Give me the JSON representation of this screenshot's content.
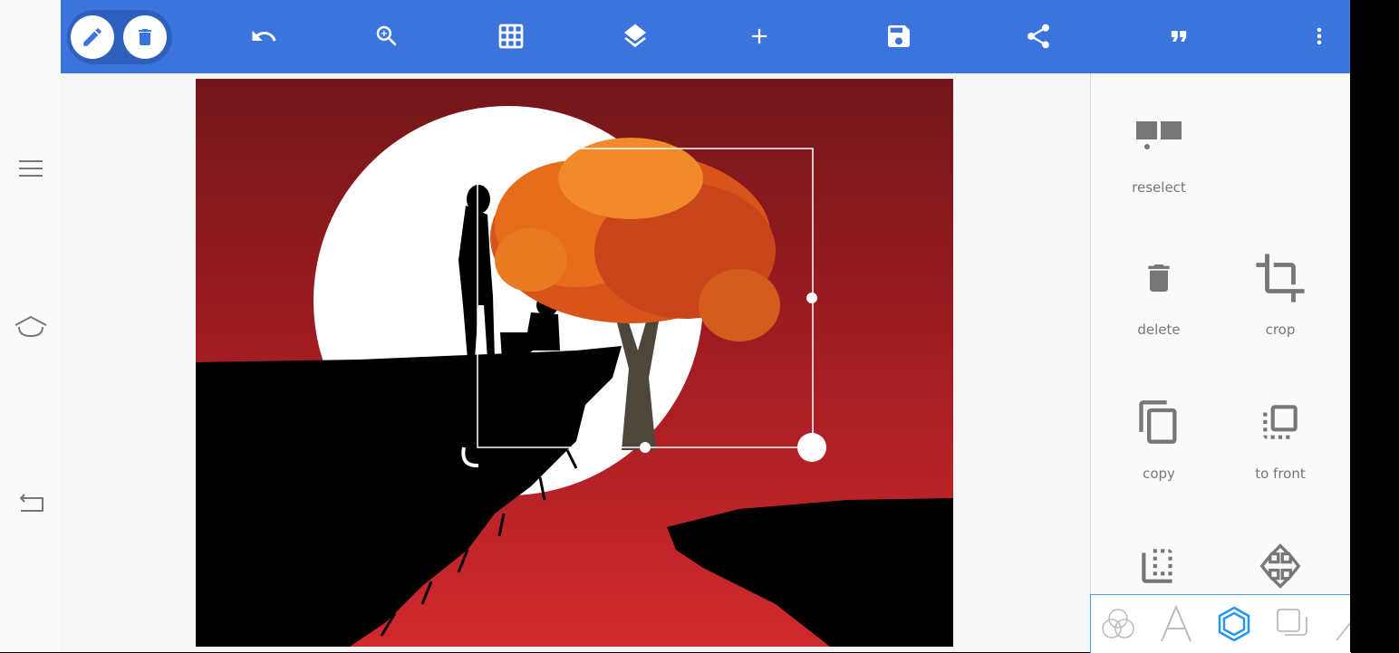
{
  "toolbar": {
    "icons": [
      "pencil-icon",
      "trash-icon",
      "undo-icon",
      "zoom-in-icon",
      "grid-icon",
      "layers-icon",
      "plus-icon",
      "save-icon",
      "share-icon",
      "quote-icon",
      "more-vert-icon"
    ],
    "accent": "#3b74dd"
  },
  "navbar": {
    "icons": [
      "menu-icon",
      "home-icon",
      "back-icon"
    ]
  },
  "panel": {
    "actions": [
      {
        "label": "reselect",
        "icon": "reselect-icon"
      },
      {
        "label": "delete",
        "icon": "trash-icon"
      },
      {
        "label": "crop",
        "icon": "crop-icon"
      },
      {
        "label": "copy",
        "icon": "copy-icon"
      },
      {
        "label": "to front",
        "icon": "to-front-icon"
      },
      {
        "label": "",
        "icon": "to-back-icon"
      },
      {
        "label": "",
        "icon": "move-icon"
      }
    ]
  },
  "tabs": {
    "icons": [
      "blend-icon",
      "text-icon",
      "shape-icon",
      "layer-icon",
      "line-icon"
    ],
    "active": "shape-icon",
    "active_color": "#2196f3"
  },
  "colors": {
    "sky_top": "#721619",
    "sky_bottom": "#d0292d",
    "moon": "#ffffff",
    "foliage": "#e0631a"
  }
}
